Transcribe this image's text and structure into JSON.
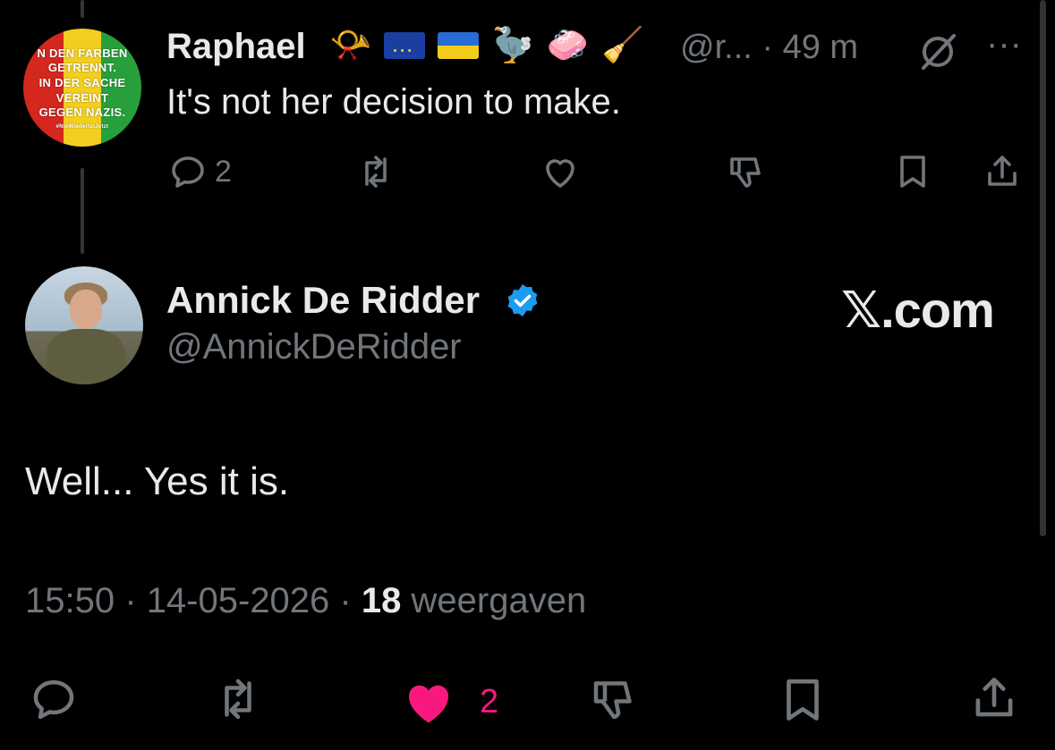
{
  "reply": {
    "avatar_text": [
      "N DEN FARBEN",
      "GETRENNT.",
      "IN DER SACHE",
      "VEREINT",
      "GEGEN NAZIS.",
      "#NieWiederIstJetzt"
    ],
    "name": "Raphael",
    "emojis": [
      "📯",
      "eu-flag",
      "ukraine-flag",
      "🦤",
      "🧼",
      "🧹"
    ],
    "handle": "@r...",
    "time": "· 49 m",
    "more": "···",
    "text": "It's not her decision to make.",
    "actions": {
      "reply_count": "2",
      "retweet_count": "",
      "like_count": "",
      "dislike_count": ""
    }
  },
  "tweet": {
    "name": "Annick De Ridder",
    "handle": "@AnnickDeRidder",
    "brand": "𝕏.com",
    "text": "Well... Yes it is.",
    "time": "15:50",
    "separator": "·",
    "date": "14-05-2026",
    "views_count": "18",
    "views_label": "weergaven",
    "actions": {
      "like_count": "2"
    }
  },
  "colors": {
    "background": "#000000",
    "text": "#e7e9ea",
    "secondary": "#71767b",
    "like": "#f91880",
    "verified": "#1d9bf0"
  }
}
